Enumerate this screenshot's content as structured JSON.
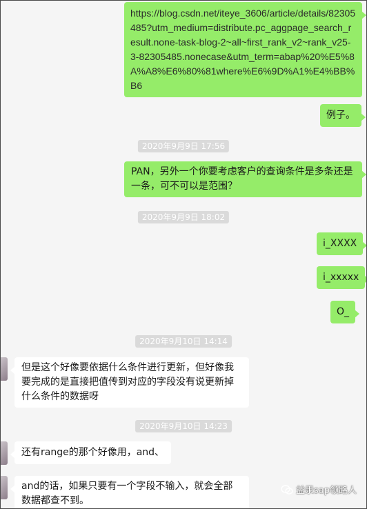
{
  "messages": [
    {
      "side": "out",
      "text": "https://blog.csdn.net/iteye_3606/article/details/82305485?utm_medium=distribute.pc_aggpage_search_result.none-task-blog-2~all~first_rank_v2~rank_v25-3-82305485.nonecase&utm_term=abap%20%E5%8A%A8%E6%80%81where%E6%9D%A1%E4%BB%B6"
    },
    {
      "side": "out",
      "text": "例子。"
    },
    {
      "timestamp": "2020年9月9日 17:56"
    },
    {
      "side": "out",
      "text": "PAN，另外一个你要考虑客户的查询条件是多条还是一条，可不可以是范围？"
    },
    {
      "timestamp": "2020年9月9日 18:02"
    },
    {
      "side": "out",
      "text": "i_XXXX"
    },
    {
      "side": "out",
      "text": "i_xxxxx"
    },
    {
      "side": "out",
      "text": "O_"
    },
    {
      "timestamp": "2020年9月10日 14:14"
    },
    {
      "side": "in",
      "text": "但是这个好像要依据什么条件进行更新，但好像我要完成的是直接把值传到对应的字段没有说更新掉什么条件的数据呀"
    },
    {
      "timestamp": "2020年9月10日 14:23"
    },
    {
      "side": "in",
      "text": "还有range的那个好像用，and、"
    },
    {
      "side": "in",
      "text": "and的话，如果只要有一个字段不输入，就会全部数据都查不到。"
    }
  ],
  "watermark": "益汞sap领路人",
  "colors": {
    "outgoing": "#95ec69",
    "incoming": "#ffffff",
    "timestamp_bg": "#dadada",
    "background": "#f5f5f5"
  }
}
